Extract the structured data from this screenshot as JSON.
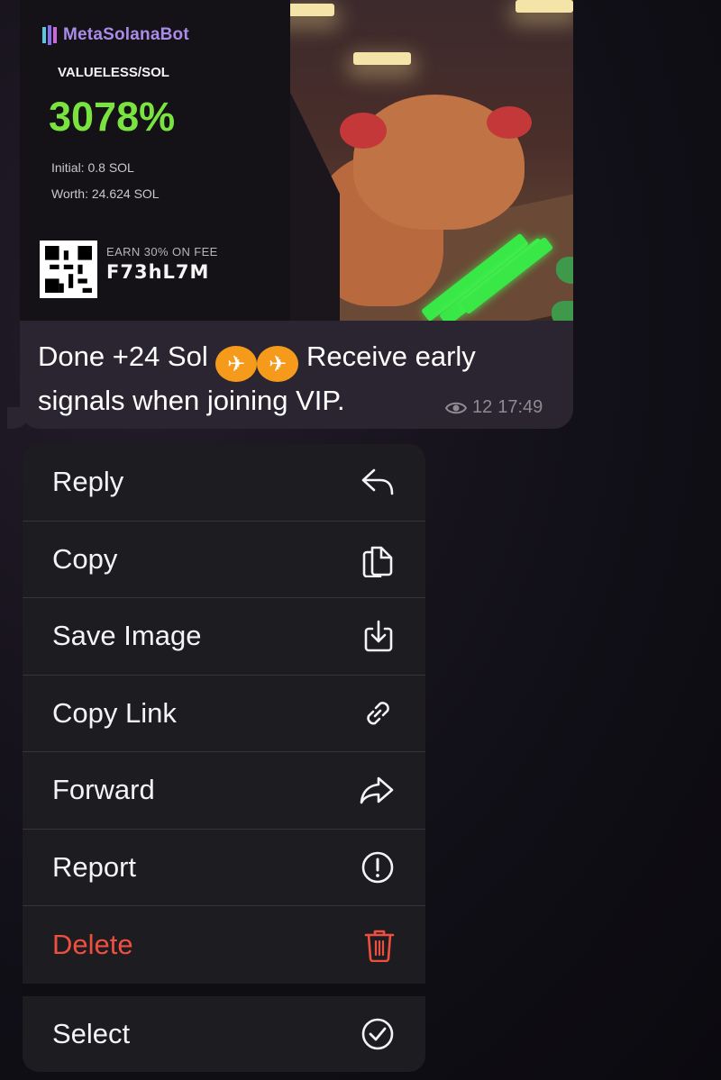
{
  "card": {
    "brand": "MetaSolanaBot",
    "pair": "VALUELESS/SOL",
    "percent": "3078%",
    "initial": "Initial: 0.8 SOL",
    "worth": "Worth: 24.624 SOL",
    "earn_caption": "EARN 30% ON FEE",
    "earn_code": "F73hL7M",
    "accent_green": "#7be33f",
    "brand_color": "#a98ce8"
  },
  "message": {
    "text_part1": "Done +24 Sol",
    "emoji": [
      "airplane-badge-icon",
      "airplane-badge-icon"
    ],
    "text_part2": "Receive early",
    "text_line2": "signals when joining VIP.",
    "views": "12",
    "time": "17:49"
  },
  "menu": {
    "items": [
      {
        "label": "Reply",
        "icon": "reply-icon"
      },
      {
        "label": "Copy",
        "icon": "copy-icon"
      },
      {
        "label": "Save Image",
        "icon": "save-image-icon"
      },
      {
        "label": "Copy Link",
        "icon": "link-icon"
      },
      {
        "label": "Forward",
        "icon": "forward-icon"
      },
      {
        "label": "Report",
        "icon": "report-icon"
      },
      {
        "label": "Delete",
        "icon": "trash-icon",
        "color": "#ef4f3f"
      }
    ],
    "select": {
      "label": "Select",
      "icon": "select-check-icon"
    }
  }
}
